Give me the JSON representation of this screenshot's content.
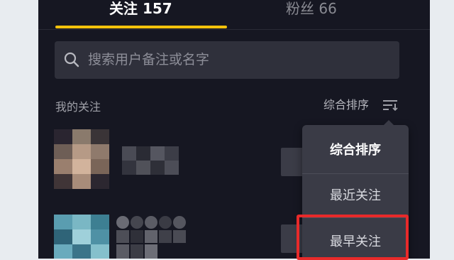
{
  "tabs": {
    "following_label": "关注 157",
    "fans_label": "粉丝 66"
  },
  "search": {
    "placeholder": "搜索用户备注或名字"
  },
  "section": {
    "title": "我的关注"
  },
  "sort": {
    "current_label": "综合排序",
    "icon": "sort-lines-icon",
    "options": [
      {
        "label": "综合排序",
        "active": true
      },
      {
        "label": "最近关注",
        "active": false
      },
      {
        "label": "最早关注",
        "active": false
      }
    ]
  },
  "colors": {
    "background": "#161722",
    "accent_underline": "#f5c20b",
    "menu_background": "#3a3b46",
    "highlight_border": "#e82a2a"
  }
}
